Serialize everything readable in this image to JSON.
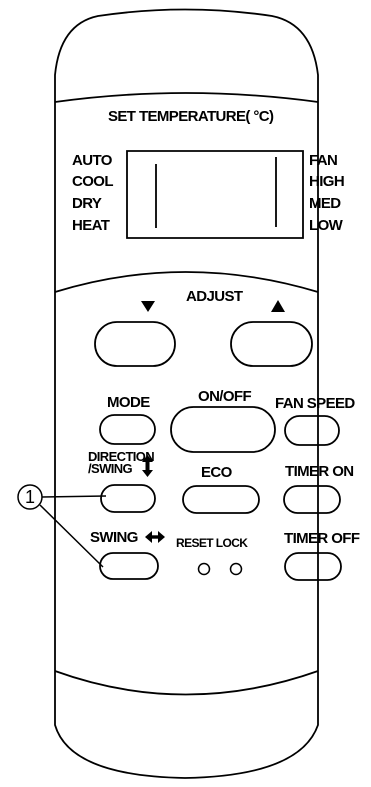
{
  "display": {
    "title": "SET TEMPERATURE( °C)",
    "modes_left": [
      "AUTO",
      "COOL",
      "DRY",
      "HEAT"
    ],
    "fan_right": [
      "FAN",
      "HIGH",
      "MED",
      "LOW"
    ]
  },
  "adjust": {
    "label": "ADJUST",
    "down_icon": "triangle-down-icon",
    "up_icon": "triangle-up-icon"
  },
  "buttons": {
    "mode": "MODE",
    "on_off": "ON/OFF",
    "fan_speed": "FAN SPEED",
    "direction_line1": "DIRECTION",
    "direction_line2": "/SWING",
    "direction_icon": "up-down-arrow-icon",
    "eco": "ECO",
    "timer_on": "TIMER ON",
    "swing": "SWING",
    "swing_icon": "left-right-arrow-icon",
    "reset_lock": "RESET LOCK",
    "timer_off": "TIMER OFF"
  },
  "callout": {
    "number": "1"
  }
}
